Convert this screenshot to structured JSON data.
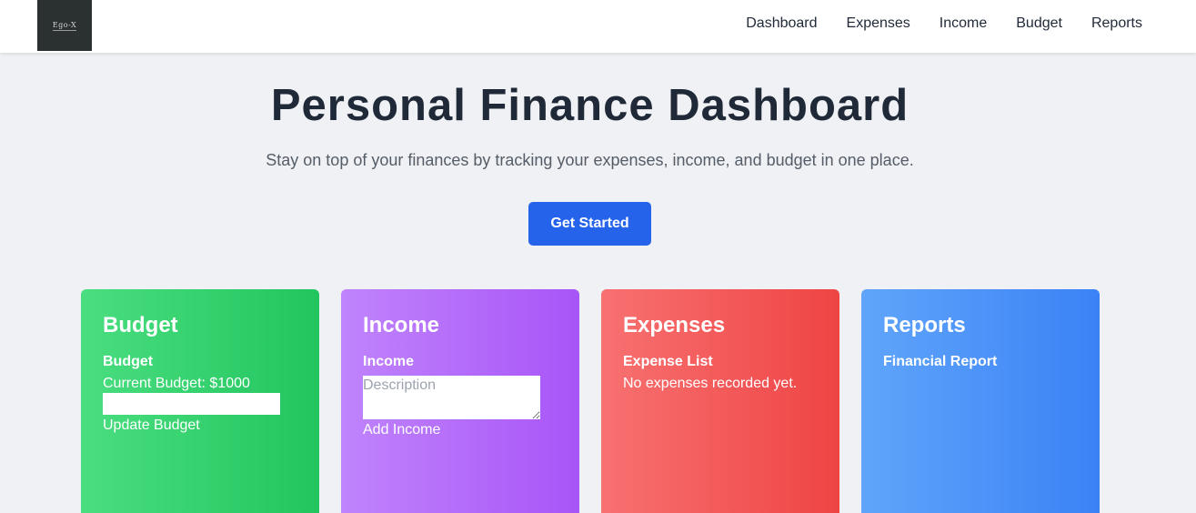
{
  "nav": {
    "logo_text": "Ego-X",
    "links": [
      "Dashboard",
      "Expenses",
      "Income",
      "Budget",
      "Reports"
    ]
  },
  "hero": {
    "title": "Personal Finance Dashboard",
    "subtitle": "Stay on top of your finances by tracking your expenses, income, and budget in one place.",
    "cta_label": "Get Started"
  },
  "cards": {
    "budget": {
      "title": "Budget",
      "subtitle": "Budget",
      "current_label": "Current Budget: $1000",
      "input_value": "",
      "input_placeholder": "",
      "button_label": "Update Budget"
    },
    "income": {
      "title": "Income",
      "subtitle": "Income",
      "description_placeholder": "Description",
      "button_label": "Add Income"
    },
    "expenses": {
      "title": "Expenses",
      "subtitle": "Expense List",
      "empty_text": "No expenses recorded yet."
    },
    "reports": {
      "title": "Reports",
      "subtitle": "Financial Report"
    }
  },
  "colors": {
    "primary": "#2563eb",
    "budget_card": "#22c55e",
    "income_card": "#a855f7",
    "expenses_card": "#ef4444",
    "reports_card": "#3b82f6",
    "background": "#f0f1f4"
  }
}
